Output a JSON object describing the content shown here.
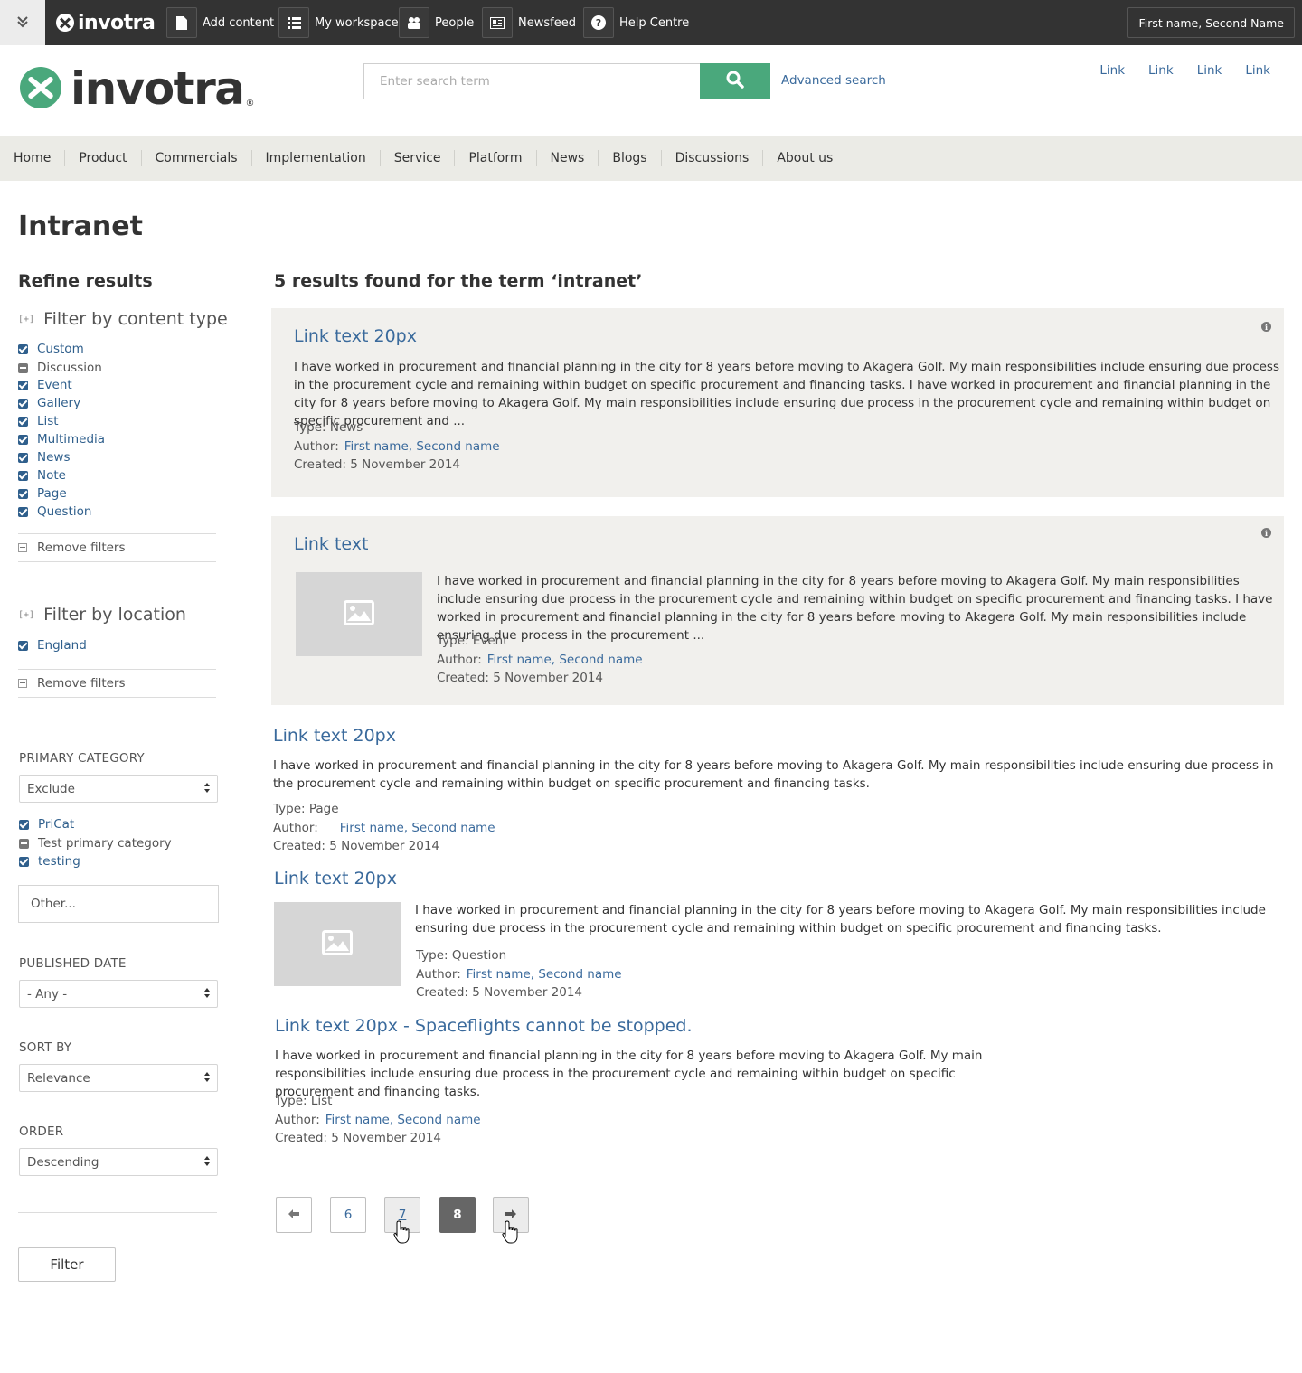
{
  "topbar": {
    "logo_text": "invotra",
    "add_content": "Add content",
    "my_workspace": "My workspace",
    "people": "People",
    "newsfeed": "Newsfeed",
    "help_centre": "Help Centre",
    "user_name": "First name, Second Name"
  },
  "header": {
    "logo_text": "invotra",
    "logo_reg": "®",
    "search_placeholder": "Enter search term",
    "advanced_search": "Advanced search",
    "links": [
      "Link",
      "Link",
      "Link",
      "Link"
    ]
  },
  "nav": [
    "Home",
    "Product",
    "Commercials",
    "Implementation",
    "Service",
    "Platform",
    "News",
    "Blogs",
    "Discussions",
    "About us"
  ],
  "page_title": "Intranet",
  "sidebar": {
    "title": "Refine results",
    "content_type": {
      "heading": "Filter by content type",
      "toggle": "[+]",
      "items": [
        {
          "label": "Custom",
          "state": "checked"
        },
        {
          "label": "Discussion",
          "state": "mixed"
        },
        {
          "label": "Event",
          "state": "checked"
        },
        {
          "label": "Gallery",
          "state": "checked"
        },
        {
          "label": "List",
          "state": "checked"
        },
        {
          "label": "Multimedia",
          "state": "checked"
        },
        {
          "label": "News",
          "state": "checked"
        },
        {
          "label": "Note",
          "state": "checked"
        },
        {
          "label": "Page",
          "state": "checked"
        },
        {
          "label": "Question",
          "state": "checked"
        }
      ],
      "remove": "Remove filters"
    },
    "location": {
      "heading": "Filter by location",
      "toggle": "[+]",
      "items": [
        {
          "label": "England",
          "state": "checked"
        }
      ],
      "remove": "Remove filters"
    },
    "primary_category": {
      "label": "PRIMARY CATEGORY",
      "select_value": "Exclude",
      "items": [
        {
          "label": "PriCat",
          "state": "checked"
        },
        {
          "label": "Test primary category",
          "state": "mixed"
        },
        {
          "label": "testing",
          "state": "checked"
        }
      ],
      "other_placeholder": "Other..."
    },
    "published_date": {
      "label": "PUBLISHED DATE",
      "value": "- Any -"
    },
    "sort_by": {
      "label": "SORT BY",
      "value": "Relevance"
    },
    "order": {
      "label": "ORDER",
      "value": "Descending"
    },
    "filter_button": "Filter"
  },
  "results": {
    "heading": "5 results found for the term ‘intranet’",
    "items": [
      {
        "title": "Link text 20px",
        "body": "I have worked in procurement and financial planning in the city for 8 years before moving to Akagera Golf. My main responsibilities include ensuring due process in the procurement cycle and remaining within budget on specific procurement and financing tasks. I have worked in procurement and financial planning in the city for 8 years before moving to Akagera Golf. My main responsibilities include ensuring due process in the procurement cycle and remaining within budget on specific procurement and ...",
        "type": "Type: News",
        "author_label": "Author:",
        "author": "First name, Second name",
        "created": "Created: 5 November 2014"
      },
      {
        "title": "Link text",
        "body": "I have worked in procurement and financial planning in the city for 8 years before moving to Akagera Golf. My main responsibilities include ensuring due process in the procurement cycle and remaining within budget on specific procurement and financing tasks. I have worked in procurement and financial planning in the city for 8 years before moving to Akagera Golf. My main responsibilities include ensuring due process in the procurement ...",
        "type": "Type: Event",
        "author_label": "Author:",
        "author": "First name, Second name",
        "created": "Created: 5 November 2014"
      },
      {
        "title": "Link text 20px",
        "body": "I have worked in procurement and financial planning in the city for 8 years before moving to Akagera Golf. My main responsibilities include ensuring due process in the procurement cycle and remaining within budget on specific procurement and financing tasks.",
        "type": "Type: Page",
        "author_label": "Author:",
        "author": "First name, Second name",
        "created": "Created: 5 November 2014"
      },
      {
        "title": "Link text 20px",
        "body": "I have worked in procurement and financial planning in the city for 8 years before moving to Akagera Golf. My main responsibilities include ensuring due process in the procurement cycle and remaining within budget on specific procurement and financing tasks.",
        "type": "Type: Question",
        "author_label": "Author:",
        "author": "First name, Second name",
        "created": "Created: 5 November 2014"
      },
      {
        "title": "Link text 20px - Spaceflights cannot be stopped.",
        "body": "I have worked in procurement and financial planning in the city for 8 years before moving to Akagera Golf. My main responsibilities include ensuring due process in the procurement cycle and remaining within budget on specific procurement and financing tasks.",
        "type": "Type: List",
        "author_label": "Author:",
        "author": "First name, Second name",
        "created": "Created: 5 November 2014"
      }
    ]
  },
  "pager": {
    "pages": [
      "6",
      "7",
      "8"
    ],
    "current": "8"
  },
  "colors": {
    "brand_green": "#4aa87c",
    "link_blue": "#3a6a9c",
    "topbar": "#333333",
    "card_bg": "#f1f0ed"
  }
}
